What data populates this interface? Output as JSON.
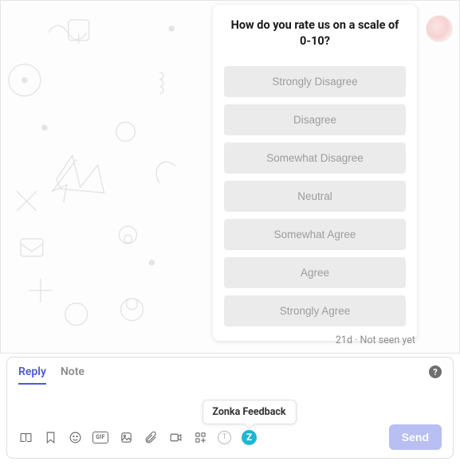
{
  "survey": {
    "title": "How do you rate us on a scale of 0-10?",
    "options": [
      "Strongly Disagree",
      "Disagree",
      "Somewhat Disagree",
      "Neutral",
      "Somewhat Agree",
      "Agree",
      "Strongly Agree"
    ]
  },
  "meta": {
    "timestamp": "21d",
    "status": "Not seen yet"
  },
  "composer": {
    "tabs": {
      "reply": "Reply",
      "note": "Note"
    },
    "tooltip": "Zonka Feedback",
    "gif_label": "GIF",
    "text_label": "T",
    "zonka_label": "Z",
    "send_label": "Send"
  },
  "colors": {
    "accent": "#4b5bd9",
    "option_bg": "#ebebeb",
    "send_bg": "#b8bff2",
    "zonka": "#1fb6d4"
  }
}
